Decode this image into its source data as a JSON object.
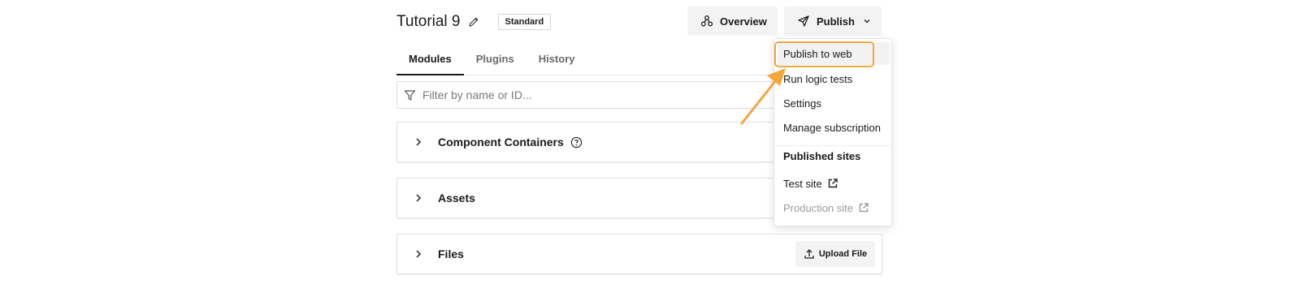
{
  "header": {
    "title": "Tutorial 9",
    "badge": "Standard"
  },
  "toolbar": {
    "overview_label": "Overview",
    "publish_label": "Publish"
  },
  "tabs": [
    {
      "label": "Modules",
      "active": true
    },
    {
      "label": "Plugins",
      "active": false
    },
    {
      "label": "History",
      "active": false
    }
  ],
  "filter": {
    "placeholder": "Filter by name or ID..."
  },
  "panels": [
    {
      "title": "Component Containers"
    },
    {
      "title": "Assets"
    },
    {
      "title": "Files",
      "action_label": "Upload File"
    }
  ],
  "publish_menu": {
    "items": [
      {
        "label": "Publish to web"
      },
      {
        "label": "Run logic tests"
      },
      {
        "label": "Settings"
      },
      {
        "label": "Manage subscription"
      }
    ],
    "sites_heading": "Published sites",
    "sites": [
      {
        "label": "Test site",
        "enabled": true
      },
      {
        "label": "Production site",
        "enabled": false
      }
    ]
  },
  "colors": {
    "highlight_ring": "#f5a63a",
    "button_bg": "#f3f3f3"
  }
}
